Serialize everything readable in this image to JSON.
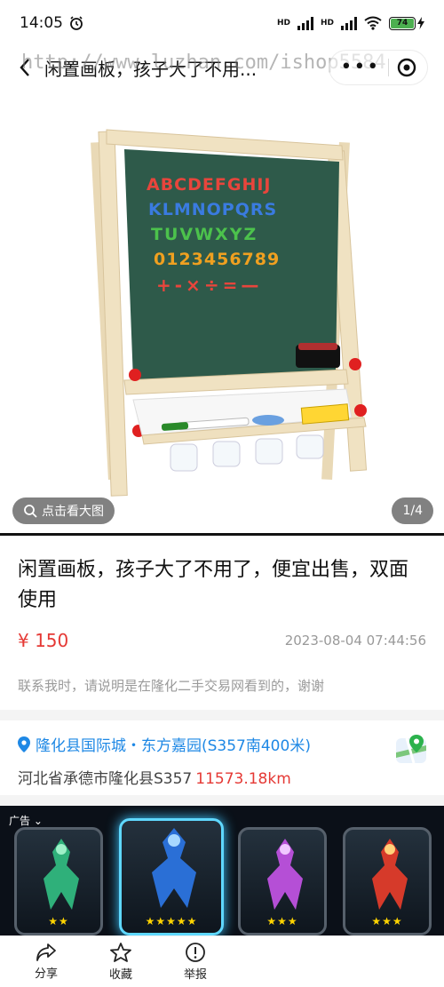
{
  "status_bar": {
    "time": "14:05",
    "signal_label_1": "HD",
    "signal_label_2": "HD",
    "battery": "74"
  },
  "nav": {
    "title": "闲置画板，孩子大了不用...",
    "watermark": "http://www.luzhan.com/ishop5584",
    "more_icon": "more-dots-icon",
    "close_icon": "capsule-close-icon"
  },
  "gallery": {
    "zoom_label": "点击看大图",
    "page_indicator": "1/4",
    "board_letters_row1": "ABCDEFGHIJ",
    "board_letters_row2": "KLMNOPQRS",
    "board_letters_row3": "TUVWXYZ",
    "board_letters_row4": "0123456789",
    "board_letters_row5": "+-×÷=—"
  },
  "listing": {
    "title": "闲置画板，孩子大了不用了，便宜出售，双面使用",
    "price": "¥ 150",
    "posted_at": "2023-08-04 07:44:56",
    "note": "联系我时，请说明是在隆化二手交易网看到的，谢谢"
  },
  "location": {
    "name": "隆化县国际城・东方嘉园(S357南400米)",
    "address": "河北省承德市隆化县S357",
    "distance": "11573.18km"
  },
  "ad": {
    "label": "广告",
    "cards": [
      {
        "stars": "★★"
      },
      {
        "stars": "★★★★★"
      },
      {
        "stars": "★★★"
      },
      {
        "stars": "★★★"
      }
    ]
  },
  "bottom_bar": {
    "share": "分享",
    "favorite": "收藏",
    "report": "举报"
  },
  "colors": {
    "accent_blue": "#1e88e5",
    "price_red": "#e53935",
    "battery_green": "#4caf50"
  }
}
